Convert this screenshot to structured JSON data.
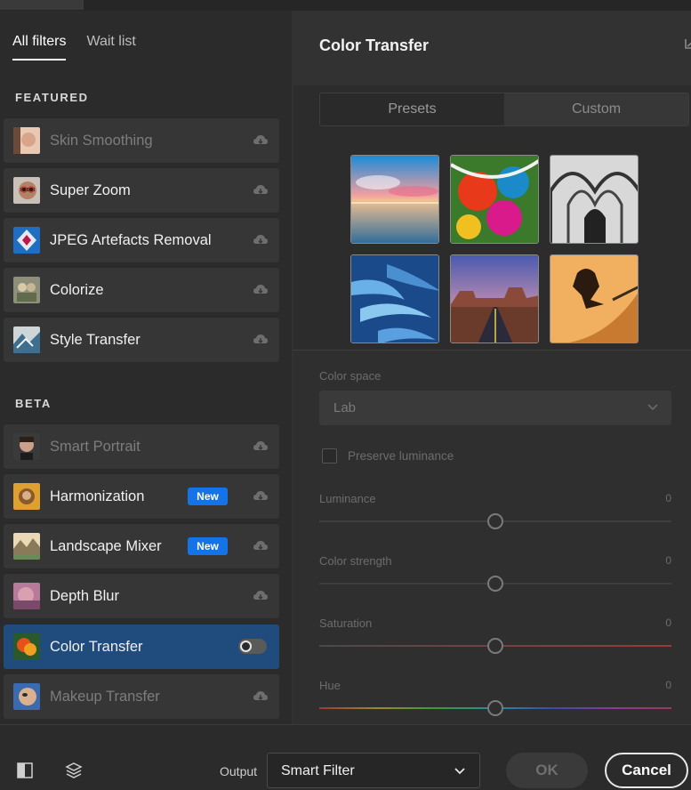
{
  "tabs": [
    {
      "label": "All filters",
      "active": true
    },
    {
      "label": "Wait list",
      "active": false
    }
  ],
  "sections": {
    "featured": "FEATURED",
    "beta": "BETA"
  },
  "featured_filters": [
    {
      "label": "Skin Smoothing",
      "dim": true,
      "icon": "cloud-download-icon"
    },
    {
      "label": "Super Zoom",
      "dim": false,
      "icon": "cloud-download-icon"
    },
    {
      "label": "JPEG Artefacts Removal",
      "dim": false,
      "icon": "cloud-download-icon"
    },
    {
      "label": "Colorize",
      "dim": false,
      "icon": "cloud-download-icon"
    },
    {
      "label": "Style Transfer",
      "dim": false,
      "icon": "cloud-download-icon"
    }
  ],
  "beta_filters": [
    {
      "label": "Smart Portrait",
      "dim": true,
      "icon": "cloud-download-icon"
    },
    {
      "label": "Harmonization",
      "dim": false,
      "badge": "New",
      "icon": "cloud-download-icon"
    },
    {
      "label": "Landscape Mixer",
      "dim": false,
      "badge": "New",
      "icon": "cloud-download-icon"
    },
    {
      "label": "Depth Blur",
      "dim": false,
      "icon": "cloud-download-icon"
    },
    {
      "label": "Color Transfer",
      "dim": false,
      "selected": true,
      "toggle": "off"
    },
    {
      "label": "Makeup Transfer",
      "dim": true,
      "icon": "cloud-download-icon"
    }
  ],
  "panel": {
    "title": "Color Transfer",
    "segments": [
      {
        "label": "Presets",
        "active": true
      },
      {
        "label": "Custom",
        "active": false
      }
    ],
    "presets": [
      "sunset-lake",
      "abstract-paint",
      "cathedral-arches",
      "blue-feathers",
      "desert-road",
      "skateboarder"
    ]
  },
  "controls": {
    "color_space_label": "Color space",
    "color_space_value": "Lab",
    "preserve_label": "Preserve luminance",
    "preserve_checked": false,
    "sliders": [
      {
        "label": "Luminance",
        "value": "0",
        "position": 0.5,
        "track": "neutral"
      },
      {
        "label": "Color strength",
        "value": "0",
        "position": 0.5,
        "track": "neutral"
      },
      {
        "label": "Saturation",
        "value": "0",
        "position": 0.5,
        "track": "saturation"
      },
      {
        "label": "Hue",
        "value": "0",
        "position": 0.5,
        "track": "hue"
      }
    ]
  },
  "bottom": {
    "output_label": "Output",
    "output_value": "Smart Filter",
    "ok_label": "OK",
    "cancel_label": "Cancel"
  },
  "colors": {
    "accent": "#1473e6",
    "selected_row": "#1f4b7d"
  }
}
